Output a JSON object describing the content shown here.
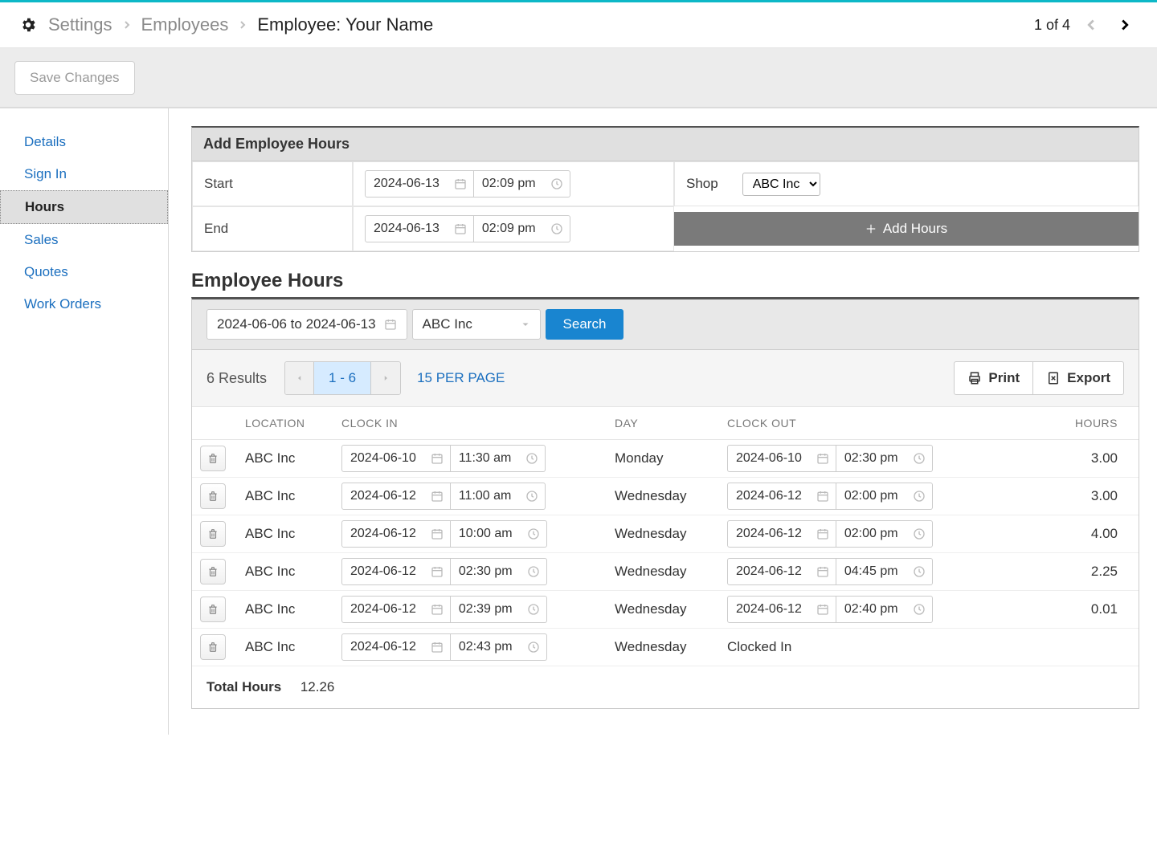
{
  "breadcrumb": {
    "settings": "Settings",
    "employees": "Employees",
    "current": "Employee:  Your Name"
  },
  "pager": {
    "text": "1 of 4"
  },
  "save_label": "Save Changes",
  "sidebar": {
    "items": [
      {
        "label": "Details"
      },
      {
        "label": "Sign In"
      },
      {
        "label": "Hours",
        "active": true
      },
      {
        "label": "Sales"
      },
      {
        "label": "Quotes"
      },
      {
        "label": "Work Orders"
      }
    ]
  },
  "add_hours": {
    "title": "Add Employee Hours",
    "start_label": "Start",
    "end_label": "End",
    "shop_label": "Shop",
    "start_date": "2024-06-13",
    "start_time": "02:09 pm",
    "end_date": "2024-06-13",
    "end_time": "02:09 pm",
    "shop_value": "ABC Inc",
    "button": "Add Hours"
  },
  "hours_section": {
    "heading": "Employee Hours",
    "date_range": "2024-06-06 to 2024-06-13",
    "shop_filter": "ABC Inc",
    "search": "Search",
    "results": "6 Results",
    "page_range": "1 - 6",
    "per_page": "15 PER PAGE",
    "print": "Print",
    "export": "Export",
    "columns": {
      "location": "LOCATION",
      "clock_in": "CLOCK IN",
      "day": "DAY",
      "clock_out": "CLOCK OUT",
      "hours": "HOURS"
    },
    "rows": [
      {
        "location": "ABC Inc",
        "in_date": "2024-06-10",
        "in_time": "11:30 am",
        "day": "Monday",
        "out_date": "2024-06-10",
        "out_time": "02:30 pm",
        "hours": "3.00"
      },
      {
        "location": "ABC Inc",
        "in_date": "2024-06-12",
        "in_time": "11:00 am",
        "day": "Wednesday",
        "out_date": "2024-06-12",
        "out_time": "02:00 pm",
        "hours": "3.00"
      },
      {
        "location": "ABC Inc",
        "in_date": "2024-06-12",
        "in_time": "10:00 am",
        "day": "Wednesday",
        "out_date": "2024-06-12",
        "out_time": "02:00 pm",
        "hours": "4.00"
      },
      {
        "location": "ABC Inc",
        "in_date": "2024-06-12",
        "in_time": "02:30 pm",
        "day": "Wednesday",
        "out_date": "2024-06-12",
        "out_time": "04:45 pm",
        "hours": "2.25"
      },
      {
        "location": "ABC Inc",
        "in_date": "2024-06-12",
        "in_time": "02:39 pm",
        "day": "Wednesday",
        "out_date": "2024-06-12",
        "out_time": "02:40 pm",
        "hours": "0.01"
      },
      {
        "location": "ABC Inc",
        "in_date": "2024-06-12",
        "in_time": "02:43 pm",
        "day": "Wednesday",
        "out_text": "Clocked In",
        "hours": ""
      }
    ],
    "total_label": "Total Hours",
    "total_value": "12.26"
  }
}
